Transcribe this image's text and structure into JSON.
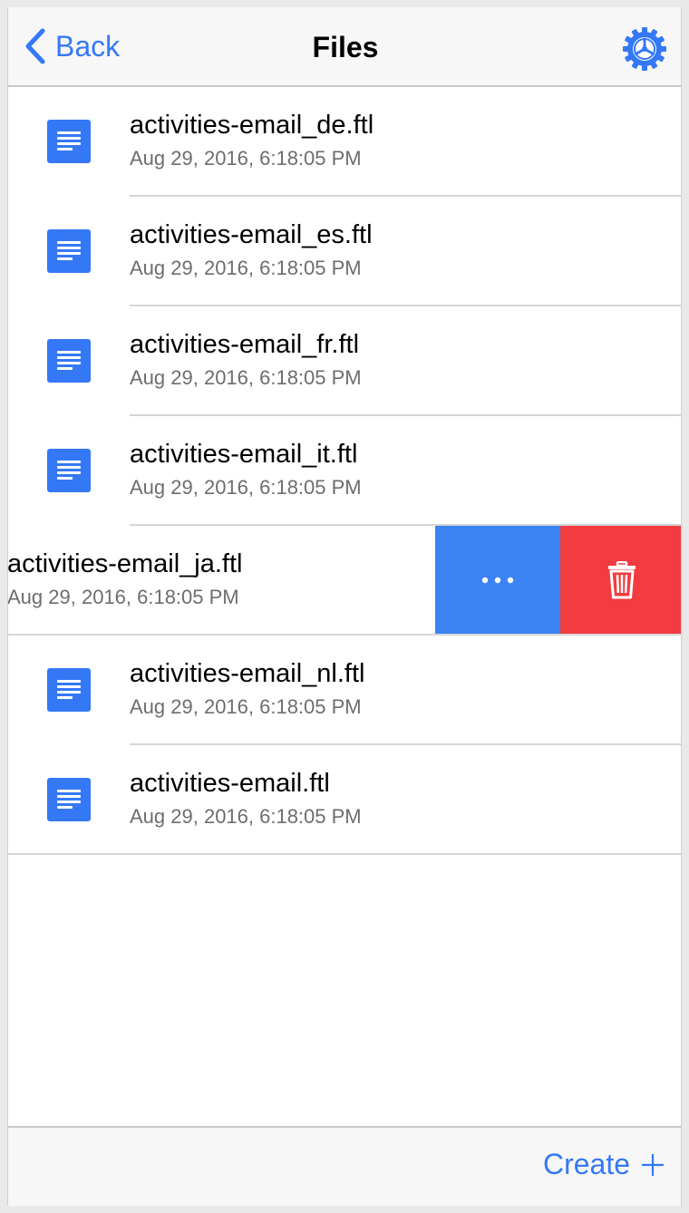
{
  "navbar": {
    "back_label": "Back",
    "title": "Files",
    "back_icon": "chevron-left-icon",
    "settings_icon": "gear-icon"
  },
  "files": [
    {
      "name": "activities-email_de.ftl",
      "date": "Aug 29, 2016, 6:18:05 PM"
    },
    {
      "name": "activities-email_es.ftl",
      "date": "Aug 29, 2016, 6:18:05 PM"
    },
    {
      "name": "activities-email_fr.ftl",
      "date": "Aug 29, 2016, 6:18:05 PM"
    },
    {
      "name": "activities-email_it.ftl",
      "date": "Aug 29, 2016, 6:18:05 PM"
    },
    {
      "name": "activities-email_ja.ftl",
      "date": "Aug 29, 2016, 6:18:05 PM",
      "swiped": true
    },
    {
      "name": "activities-email_nl.ftl",
      "date": "Aug 29, 2016, 6:18:05 PM"
    },
    {
      "name": "activities-email.ftl",
      "date": "Aug 29, 2016, 6:18:05 PM"
    }
  ],
  "swipe_actions": {
    "more_icon": "ellipsis-icon",
    "delete_icon": "trash-icon",
    "more_color": "#3b82f2",
    "delete_color": "#f33c40"
  },
  "toolbar": {
    "create_label": "Create",
    "create_icon": "plus-icon"
  },
  "colors": {
    "accent": "#3478f6",
    "file_icon": "#3478f6",
    "secondary_text": "#6d6d72"
  }
}
